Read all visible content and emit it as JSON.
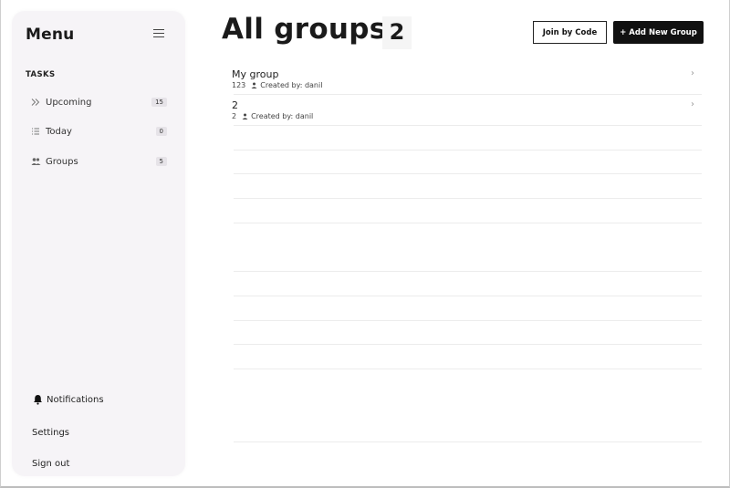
{
  "sidebar": {
    "title": "Menu",
    "section_tasks": "TASKS",
    "items": [
      {
        "label": "Upcoming",
        "count": "15",
        "icon": "double-chevron-right-icon"
      },
      {
        "label": "Today",
        "count": "0",
        "icon": "list-icon"
      },
      {
        "label": "Groups",
        "count": "5",
        "icon": "users-icon"
      }
    ],
    "bottom": {
      "notifications": "Notifications",
      "settings": "Settings",
      "signout": "Sign out"
    }
  },
  "main": {
    "title": "All groups",
    "count": "2",
    "join_label": "Join by Code",
    "add_label": "+ Add New Group",
    "groups": [
      {
        "name": "My group",
        "code": "123",
        "created": "Created by: danil"
      },
      {
        "name": "2",
        "code": "2",
        "created": "Created by: danil"
      }
    ]
  }
}
